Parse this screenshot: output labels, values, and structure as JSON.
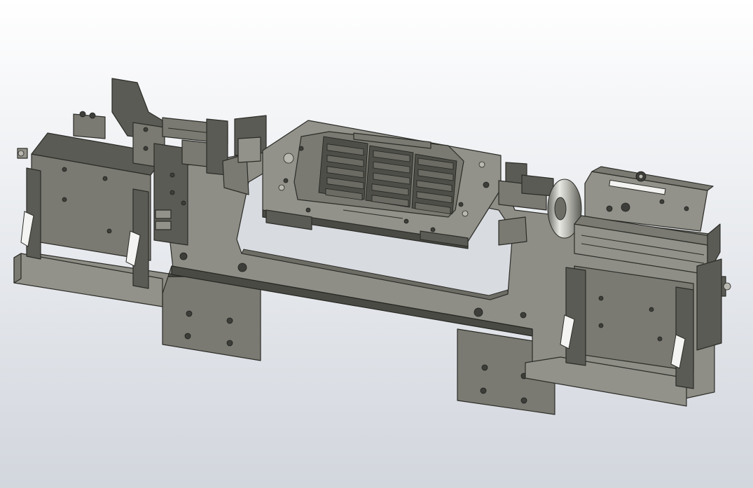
{
  "scene": {
    "type": "CAD 3D model viewport",
    "background_top": "#ffffff",
    "background_bottom": "#d2d6dd",
    "metal_color": "#7a7a72",
    "edge_color": "#2c2c28",
    "components": [
      "base-plate",
      "left-slide-fixture",
      "right-cylinder-fixture",
      "center-tray-plate",
      "left-mounting-bracket",
      "right-mounting-bracket"
    ]
  }
}
